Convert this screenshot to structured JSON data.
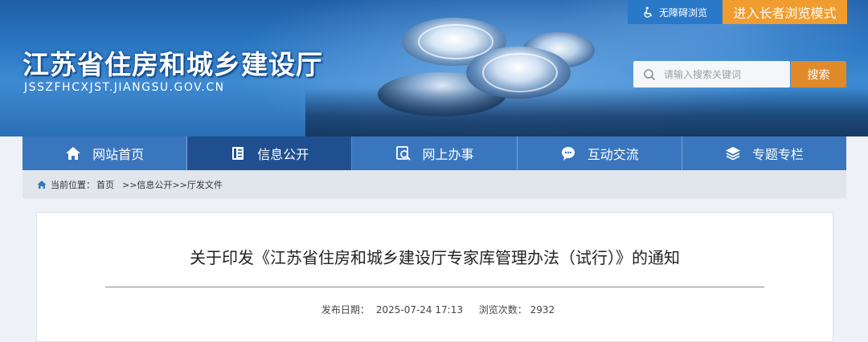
{
  "site": {
    "title": "江苏省住房和城乡建设厅",
    "domain": "JSSZFHCXJST.JIANGSU.GOV.CN"
  },
  "top_links": {
    "accessibility": "无障碍浏览",
    "elder_mode": "进入长者浏览模式"
  },
  "search": {
    "placeholder": "请输入搜索关键词",
    "button": "搜索"
  },
  "nav": {
    "items": [
      {
        "label": "网站首页",
        "icon": "home-icon"
      },
      {
        "label": "信息公开",
        "icon": "document-icon"
      },
      {
        "label": "网上办事",
        "icon": "service-icon"
      },
      {
        "label": "互动交流",
        "icon": "chat-icon"
      },
      {
        "label": "专题专栏",
        "icon": "layers-icon"
      }
    ],
    "active_index": 1
  },
  "breadcrumb": {
    "prefix": "当前位置：",
    "items": [
      "首页",
      ">>信息公开",
      ">>厅发文件"
    ]
  },
  "article": {
    "title": "关于印发《江苏省住房和城乡建设厅专家库管理办法（试行）》的通知",
    "publish_label": "发布日期：",
    "publish_date": "2025-07-24 17:13",
    "views_label": "浏览次数：",
    "views": "2932"
  },
  "colors": {
    "nav_bg": "#3a76bd",
    "nav_active": "#1f4f8f",
    "accent_orange": "#f19c2f"
  }
}
